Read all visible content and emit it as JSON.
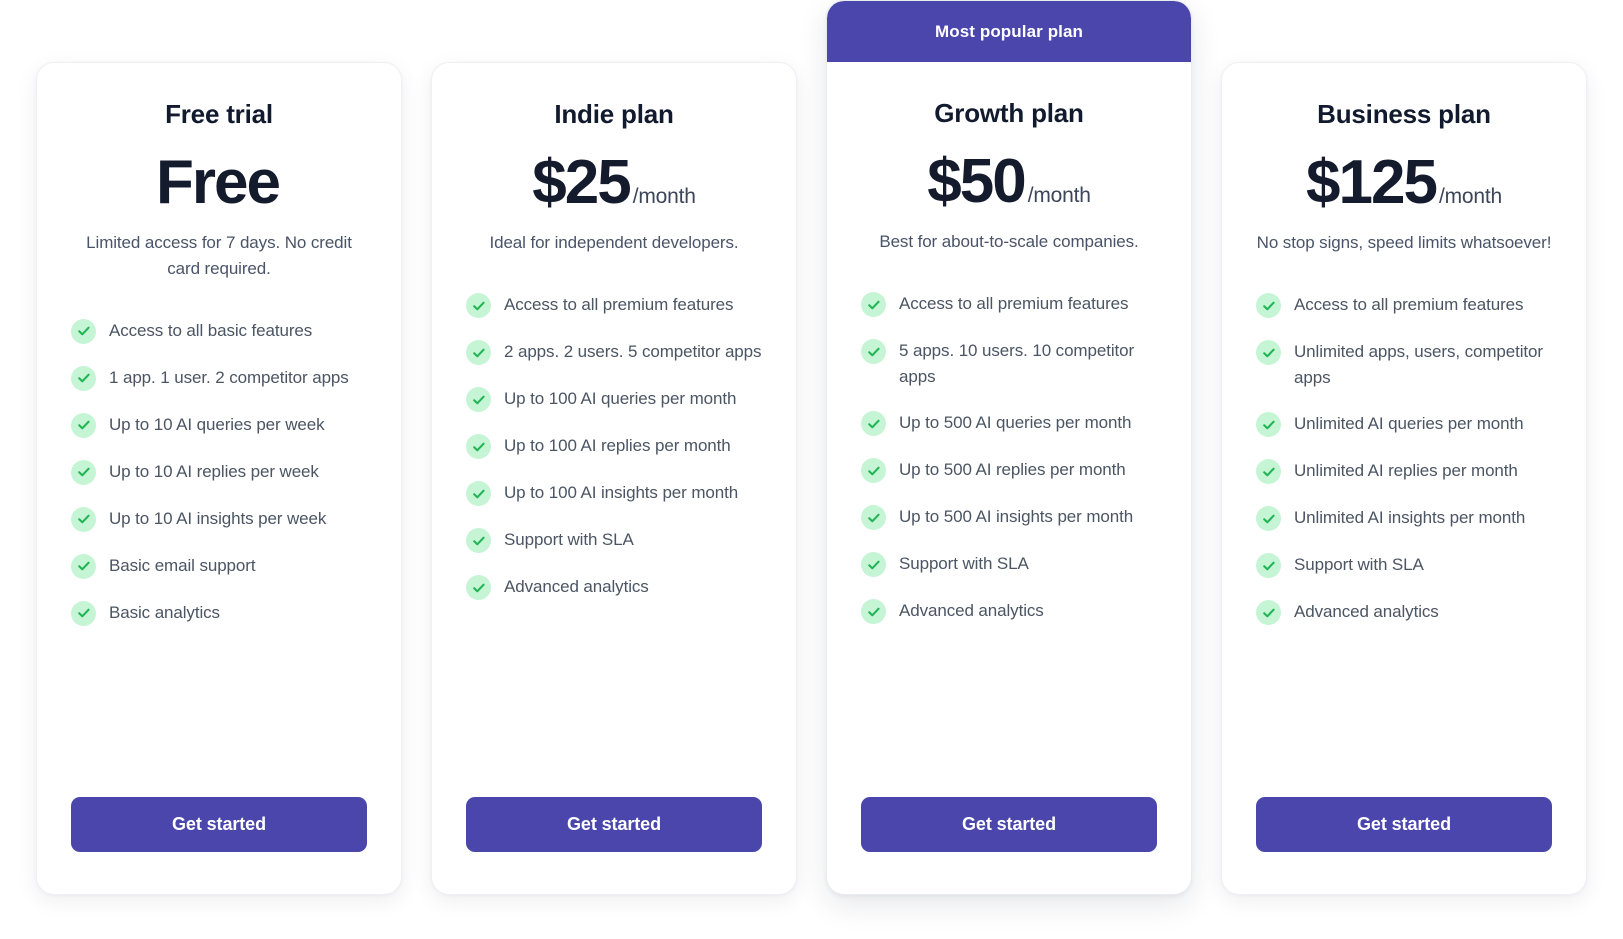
{
  "colors": {
    "brand_purple": "#4a46ac",
    "check_badge_bg": "#c5f5d5",
    "check_mark": "#22b455",
    "price_text": "#141b2d",
    "body_text": "#4b5563",
    "card_bg": "#ffffff"
  },
  "cta_label": "Get started",
  "featured_badge_label": "Most popular plan",
  "plans": [
    {
      "name": "Free trial",
      "price": "Free",
      "period": "",
      "tagline": "Limited access for 7 days. No credit card required.",
      "featured": false,
      "cta": "Get started",
      "features": [
        "Access to all basic features",
        "1 app. 1 user. 2 competitor apps",
        "Up to 10 AI queries per week",
        "Up to 10 AI replies per week",
        "Up to 10 AI insights per week",
        "Basic email support",
        "Basic analytics"
      ]
    },
    {
      "name": "Indie plan",
      "price": "$25",
      "period": "/month",
      "tagline": "Ideal for independent developers.",
      "featured": false,
      "cta": "Get started",
      "features": [
        "Access to all premium features",
        "2 apps. 2 users. 5 competitor apps",
        "Up to 100 AI queries per month",
        "Up to 100 AI replies per month",
        "Up to 100 AI insights per month",
        "Support with SLA",
        "Advanced analytics"
      ]
    },
    {
      "name": "Growth plan",
      "price": "$50",
      "period": "/month",
      "tagline": "Best for about-to-scale companies.",
      "featured": true,
      "badge": "Most popular plan",
      "cta": "Get started",
      "features": [
        "Access to all premium features",
        "5 apps. 10 users. 10 competitor apps",
        "Up to 500 AI queries per month",
        "Up to 500 AI replies per month",
        "Up to 500 AI insights per month",
        "Support with SLA",
        "Advanced analytics"
      ]
    },
    {
      "name": "Business plan",
      "price": "$125",
      "period": "/month",
      "tagline": "No stop signs, speed limits whatsoever!",
      "featured": false,
      "cta": "Get started",
      "features": [
        "Access to all premium features",
        "Unlimited apps, users, competitor apps",
        "Unlimited AI queries per month",
        "Unlimited AI replies per month",
        "Unlimited AI insights per month",
        "Support with SLA",
        "Advanced analytics"
      ]
    }
  ]
}
